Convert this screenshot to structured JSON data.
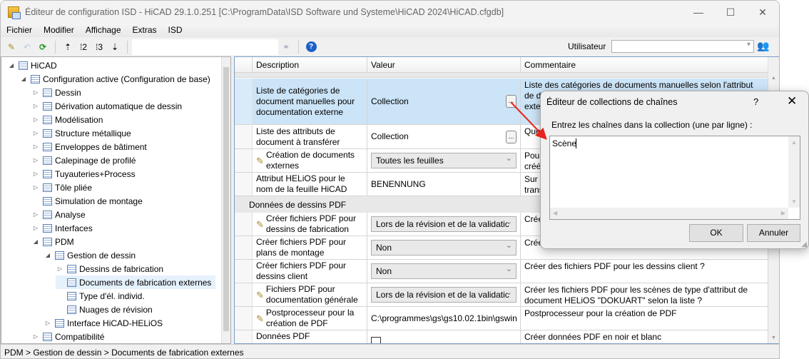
{
  "window": {
    "title": "Éditeur de configuration ISD  - HiCAD 29.1.0.251 [C:\\ProgramData\\ISD Software und Systeme\\HiCAD 2024\\HiCAD.cfgdb]",
    "minimize": "—",
    "maximize": "☐",
    "close": "✕"
  },
  "menu": [
    "Fichier",
    "Modifier",
    "Affichage",
    "Extras",
    "ISD"
  ],
  "toolbar": {
    "user_label": "Utilisateur",
    "user_value": ""
  },
  "tree": [
    {
      "label": "HiCAD",
      "level": 0,
      "tog": "◢"
    },
    {
      "label": "Configuration active (Configuration de base)",
      "level": 1,
      "tog": "◢"
    },
    {
      "label": "Dessin",
      "level": 2,
      "tog": "▷"
    },
    {
      "label": "Dérivation automatique de dessin",
      "level": 2,
      "tog": "▷"
    },
    {
      "label": "Modélisation",
      "level": 2,
      "tog": "▷"
    },
    {
      "label": "Structure métallique",
      "level": 2,
      "tog": "▷"
    },
    {
      "label": "Enveloppes de bâtiment",
      "level": 2,
      "tog": "▷"
    },
    {
      "label": "Calepinage de profilé",
      "level": 2,
      "tog": "▷"
    },
    {
      "label": "Tuyauteries+Process",
      "level": 2,
      "tog": "▷"
    },
    {
      "label": "Tôle pliée",
      "level": 2,
      "tog": "▷"
    },
    {
      "label": "Simulation de montage",
      "level": 2,
      "tog": ""
    },
    {
      "label": "Analyse",
      "level": 2,
      "tog": "▷"
    },
    {
      "label": "Interfaces",
      "level": 2,
      "tog": "▷"
    },
    {
      "label": "PDM",
      "level": 2,
      "tog": "◢"
    },
    {
      "label": "Gestion de dessin",
      "level": 3,
      "tog": "◢"
    },
    {
      "label": "Dessins de fabrication",
      "level": 4,
      "tog": "▷"
    },
    {
      "label": "Documents de fabrication externes",
      "level": 4,
      "tog": "",
      "selected": true
    },
    {
      "label": "Type d'él. individ.",
      "level": 4,
      "tog": ""
    },
    {
      "label": "Nuages de révision",
      "level": 4,
      "tog": ""
    },
    {
      "label": "Interface HiCAD-HELiOS",
      "level": 3,
      "tog": "▷"
    },
    {
      "label": "Compatibilité",
      "level": 2,
      "tog": "▷"
    }
  ],
  "grid": {
    "headers": [
      "Description",
      "Valeur",
      "Commentaire"
    ],
    "rows1": [
      {
        "desc": "Liste de catégories de document manuelles pour documentation externe",
        "value": "Collection",
        "type": "collection",
        "comment": "Liste des catégories de documents manuelles selon l'attribut de document HELiOS \"DOKUART\" pour la documentation externe sauvegardée",
        "selected": true
      },
      {
        "desc": "Liste des attributs de document à transférer",
        "value": "Collection",
        "type": "collection",
        "comment": "Quels attributs de document doivent être transférés ?"
      },
      {
        "desc": "Création de documents externes",
        "value": "Toutes les feuilles",
        "type": "combo",
        "pencil": true,
        "comment": "Pour quelles feuilles les documents externes doivent-ils être créés ?"
      },
      {
        "desc": "Attribut HELiOS pour le nom de la feuille HiCAD",
        "value": "BENENNUNG",
        "type": "text",
        "comment": "Sur quel attribut HELiOS le nom de la feuille doit-il être transféré ?"
      }
    ],
    "group": "Données de dessins PDF",
    "rows2": [
      {
        "desc": "Créer fichiers PDF pour dessins de fabrication",
        "value": "Lors de la révision et de la validatic",
        "type": "combo",
        "pencil": true,
        "comment": "Créer données PDF pour dessins de fabrication ?"
      },
      {
        "desc": "Créer fichiers PDF pour plans de montage",
        "value": "Non",
        "type": "combo",
        "comment": "Créer données PDF pour plans de montage ?"
      },
      {
        "desc": "Créer fichiers PDF pour dessins client",
        "value": "Non",
        "type": "combo",
        "comment": "Créer des fichiers PDF pour les dessins client ?"
      },
      {
        "desc": "Fichiers PDF pour documentation générale",
        "value": "Lors de la révision et de la validatic",
        "type": "combo",
        "pencil": true,
        "comment": "Créer les fichiers PDF pour les scènes de type d'attribut de document HELiOS \"DOKUART\" selon la liste ?"
      },
      {
        "desc": "Postprocesseur pour la création de PDF",
        "value": "C:\\programmes\\gs\\gs10.02.1bin\\gswin",
        "type": "text",
        "pencil": true,
        "comment": "Postprocesseur pour la création de PDF"
      },
      {
        "desc": "Données PDF monochromes",
        "value": "",
        "type": "check",
        "checked": false,
        "comment": "Créer données PDF en noir et blanc"
      }
    ]
  },
  "status": "PDM > Gestion de dessin > Documents de fabrication externes",
  "dialog": {
    "title": "Éditeur de collections de chaînes",
    "help": "?",
    "close": "✕",
    "label": "Entrez les chaînes dans la collection (une par ligne) :",
    "text": "Scène",
    "ok": "OK",
    "cancel": "Annuler"
  },
  "colors": {
    "selection": "#cce4f7",
    "arrow": "#e8221c"
  }
}
